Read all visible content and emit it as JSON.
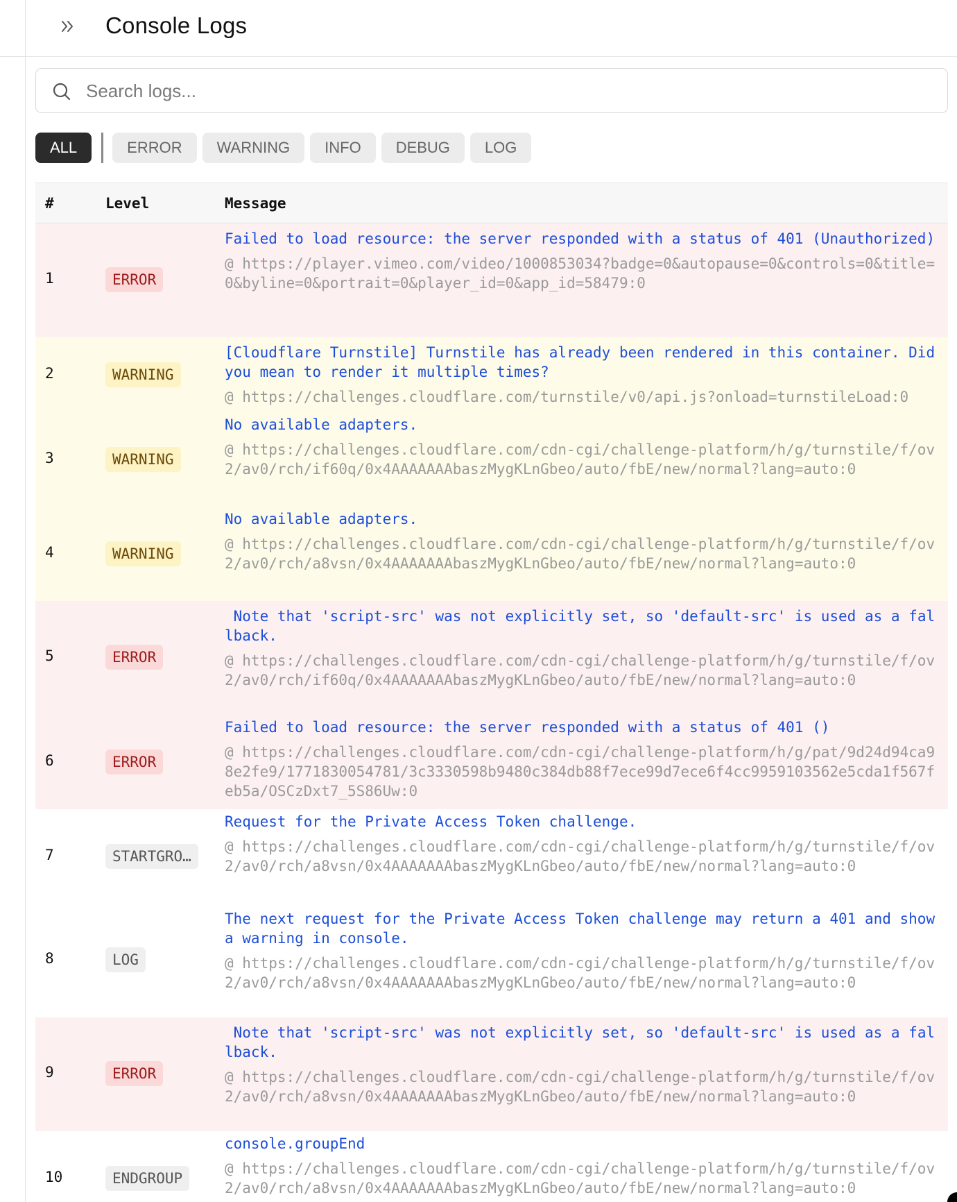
{
  "header": {
    "title": "Console Logs",
    "expand_icon": "double-chevron-right-icon"
  },
  "search": {
    "placeholder": "Search logs...",
    "value": "",
    "icon": "search-icon"
  },
  "filters": {
    "active": "ALL",
    "items": [
      "ALL",
      "ERROR",
      "WARNING",
      "INFO",
      "DEBUG",
      "LOG"
    ]
  },
  "table": {
    "columns": {
      "num": "#",
      "level": "Level",
      "message": "Message"
    },
    "rows": [
      {
        "num": "1",
        "level": "ERROR",
        "message": "Failed to load resource: the server responded with a status of 401 (Unauthorized)",
        "source": "@ https://player.vimeo.com/video/1000853034?badge=0&autopause=0&controls=0&title=0&byline=0&portrait=0&player_id=0&app_id=58479:0"
      },
      {
        "num": "2",
        "level": "WARNING",
        "message": "[Cloudflare Turnstile] Turnstile has already been rendered in this container. Did you mean to render it multiple times?",
        "source": "@ https://challenges.cloudflare.com/turnstile/v0/api.js?onload=turnstileLoad:0"
      },
      {
        "num": "3",
        "level": "WARNING",
        "message": "No available adapters.",
        "source": "@ https://challenges.cloudflare.com/cdn-cgi/challenge-platform/h/g/turnstile/f/ov2/av0/rch/if60q/0x4AAAAAAAbaszMygKLnGbeo/auto/fbE/new/normal?lang=auto:0"
      },
      {
        "num": "4",
        "level": "WARNING",
        "message": "No available adapters.",
        "source": "@ https://challenges.cloudflare.com/cdn-cgi/challenge-platform/h/g/turnstile/f/ov2/av0/rch/a8vsn/0x4AAAAAAAbaszMygKLnGbeo/auto/fbE/new/normal?lang=auto:0"
      },
      {
        "num": "5",
        "level": "ERROR",
        "message": " Note that 'script-src' was not explicitly set, so 'default-src' is used as a fallback.",
        "source": "@ https://challenges.cloudflare.com/cdn-cgi/challenge-platform/h/g/turnstile/f/ov2/av0/rch/if60q/0x4AAAAAAAbaszMygKLnGbeo/auto/fbE/new/normal?lang=auto:0"
      },
      {
        "num": "6",
        "level": "ERROR",
        "message": "Failed to load resource: the server responded with a status of 401 ()",
        "source": "@ https://challenges.cloudflare.com/cdn-cgi/challenge-platform/h/g/pat/9d24d94ca98e2fe9/1771830054781/3c3330598b9480c384db88f7ece99d7ece6f4cc9959103562e5cda1f567feb5a/OSCzDxt7_5S86Uw:0"
      },
      {
        "num": "7",
        "level": "STARTGRO…",
        "message": "Request for the Private Access Token challenge.",
        "source": "@ https://challenges.cloudflare.com/cdn-cgi/challenge-platform/h/g/turnstile/f/ov2/av0/rch/a8vsn/0x4AAAAAAAbaszMygKLnGbeo/auto/fbE/new/normal?lang=auto:0"
      },
      {
        "num": "8",
        "level": "LOG",
        "message": "The next request for the Private Access Token challenge may return a 401 and show a warning in console.",
        "source": "@ https://challenges.cloudflare.com/cdn-cgi/challenge-platform/h/g/turnstile/f/ov2/av0/rch/a8vsn/0x4AAAAAAAbaszMygKLnGbeo/auto/fbE/new/normal?lang=auto:0"
      },
      {
        "num": "9",
        "level": "ERROR",
        "message": " Note that 'script-src' was not explicitly set, so 'default-src' is used as a fallback.",
        "source": "@ https://challenges.cloudflare.com/cdn-cgi/challenge-platform/h/g/turnstile/f/ov2/av0/rch/a8vsn/0x4AAAAAAAbaszMygKLnGbeo/auto/fbE/new/normal?lang=auto:0"
      },
      {
        "num": "10",
        "level": "ENDGROUP",
        "message": "console.groupEnd",
        "source": "@ https://challenges.cloudflare.com/cdn-cgi/challenge-platform/h/g/turnstile/f/ov2/av0/rch/a8vsn/0x4AAAAAAAbaszMygKLnGbeo/auto/fbE/new/normal?lang=auto:0"
      }
    ]
  },
  "colors": {
    "error_row": "#fdf0f0",
    "warning_row": "#fefce8",
    "message_text": "#1d4ed8",
    "source_text": "#9a9a9a",
    "active_filter": "#2b2b2b"
  }
}
